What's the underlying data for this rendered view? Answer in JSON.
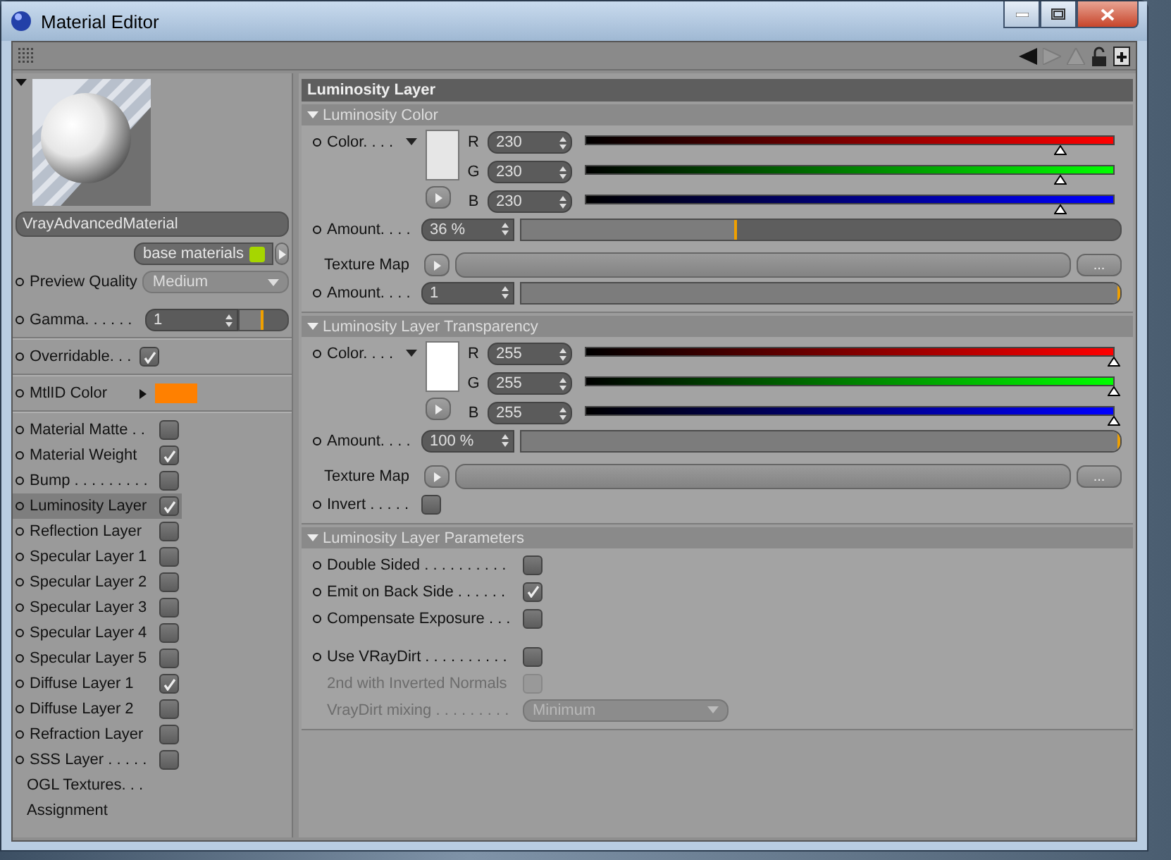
{
  "window": {
    "title": "Material Editor"
  },
  "sidebar": {
    "material_name": "VrayAdvancedMaterial",
    "base_materials": "base materials",
    "preview_quality": {
      "label": "Preview Quality",
      "value": "Medium"
    },
    "gamma": {
      "label": "Gamma. . . . . .",
      "value": "1",
      "level": 0.5
    },
    "overridable": {
      "label": "Overridable. . .",
      "checked": true
    },
    "mtlid_color": {
      "label": "MtlID Color",
      "color": "#ff8000"
    },
    "layers": [
      {
        "label": "Material Matte . .",
        "checked": false,
        "selected": false
      },
      {
        "label": "Material Weight",
        "checked": true,
        "selected": false
      },
      {
        "label": "Bump . . . . . . . . .",
        "checked": false,
        "selected": false
      },
      {
        "label": "Luminosity Layer",
        "checked": true,
        "selected": true
      },
      {
        "label": "Reflection Layer",
        "checked": false,
        "selected": false
      },
      {
        "label": "Specular Layer 1",
        "checked": false,
        "selected": false
      },
      {
        "label": "Specular Layer 2",
        "checked": false,
        "selected": false
      },
      {
        "label": "Specular Layer 3",
        "checked": false,
        "selected": false
      },
      {
        "label": "Specular Layer 4",
        "checked": false,
        "selected": false
      },
      {
        "label": "Specular Layer 5",
        "checked": false,
        "selected": false
      },
      {
        "label": "Diffuse Layer 1",
        "checked": true,
        "selected": false
      },
      {
        "label": "Diffuse Layer 2",
        "checked": false,
        "selected": false
      },
      {
        "label": "Refraction Layer",
        "checked": false,
        "selected": false
      },
      {
        "label": "SSS Layer . . . . .",
        "checked": false,
        "selected": false
      }
    ],
    "extras": [
      "OGL Textures. . .",
      "Assignment"
    ]
  },
  "main": {
    "title": "Luminosity Layer",
    "sections": [
      {
        "title": "Luminosity Color",
        "rows": [
          {
            "kind": "color",
            "label": "Color. . . .",
            "channels": [
              {
                "label": "R",
                "value": "230",
                "level": 0.9,
                "color": "#ff0000"
              },
              {
                "label": "G",
                "value": "230",
                "level": 0.9,
                "color": "#00ff00"
              },
              {
                "label": "B",
                "value": "230",
                "level": 0.9,
                "color": "#0000ff"
              }
            ]
          },
          {
            "kind": "amount",
            "label": "Amount. . . .",
            "value": "36 %",
            "level": 0.36
          },
          {
            "kind": "texture",
            "label": "Texture Map",
            "button": "..."
          },
          {
            "kind": "amount",
            "label": "Amount. . . .",
            "value": "1",
            "level": 1
          }
        ]
      },
      {
        "title": "Luminosity Layer Transparency",
        "rows": [
          {
            "kind": "color",
            "label": "Color. . . .",
            "channels": [
              {
                "label": "R",
                "value": "255",
                "level": 1,
                "color": "#ff0000"
              },
              {
                "label": "G",
                "value": "255",
                "level": 1,
                "color": "#00ff00"
              },
              {
                "label": "B",
                "value": "255",
                "level": 1,
                "color": "#0000ff"
              }
            ]
          },
          {
            "kind": "amount",
            "label": "Amount. . . .",
            "value": "100 %",
            "level": 1
          },
          {
            "kind": "texture",
            "label": "Texture Map",
            "button": "..."
          },
          {
            "kind": "checkbox",
            "label": "Invert . . . . .",
            "checked": false,
            "disabled": false
          }
        ]
      },
      {
        "title": "Luminosity Layer Parameters",
        "rows": [
          {
            "kind": "checkbox",
            "label": "Double Sided . . . . . . . . . .",
            "checked": false,
            "disabled": false
          },
          {
            "kind": "checkbox",
            "label": "Emit on Back Side . . . . . .",
            "checked": true,
            "disabled": false
          },
          {
            "kind": "checkbox",
            "label": "Compensate Exposure . . .",
            "checked": false,
            "disabled": false
          },
          {
            "kind": "spacer"
          },
          {
            "kind": "checkbox",
            "label": "Use VRayDirt . . . . . . . . . .",
            "checked": false,
            "disabled": false
          },
          {
            "kind": "checkbox",
            "label": "2nd with Inverted Normals",
            "checked": false,
            "disabled": true
          },
          {
            "kind": "dropdown",
            "label": "VrayDirt mixing . . . . . . . . .",
            "value": "Minimum",
            "disabled": true
          }
        ]
      }
    ]
  }
}
